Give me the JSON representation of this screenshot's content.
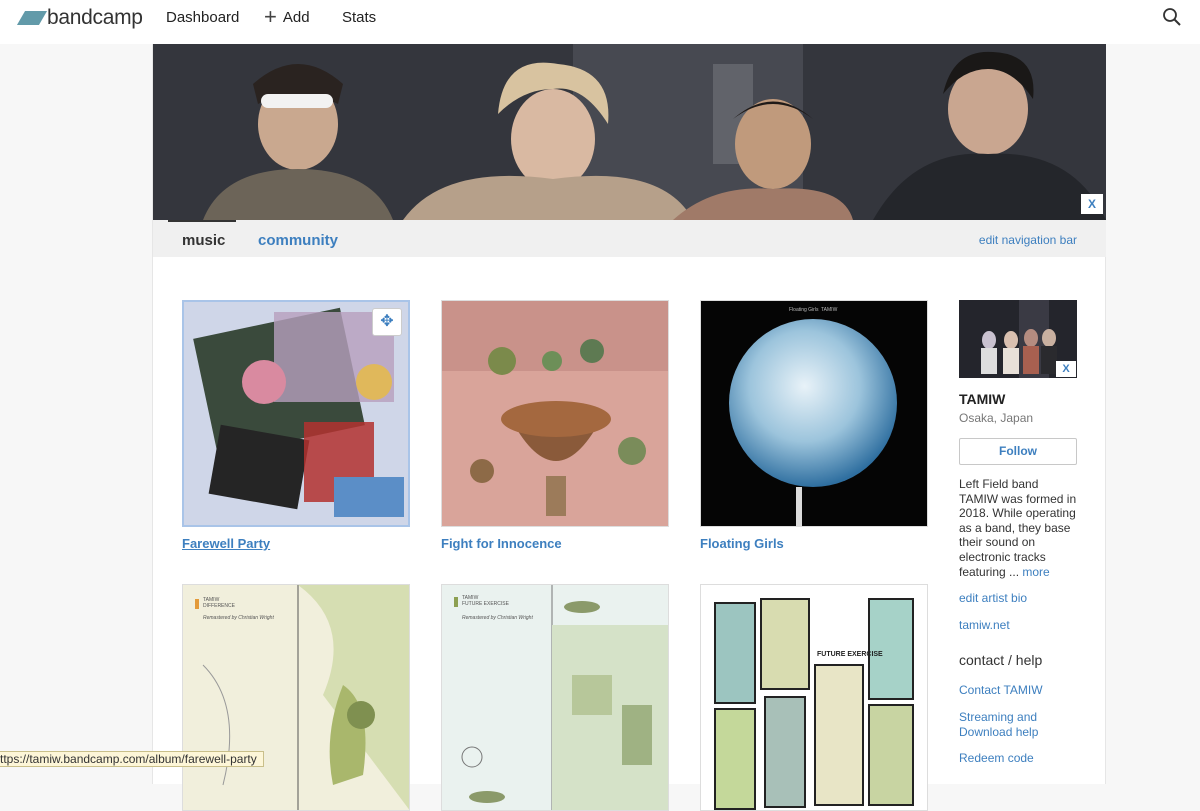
{
  "topbar": {
    "logo_text": "bandcamp",
    "nav": {
      "dashboard": "Dashboard",
      "add": "Add",
      "stats": "Stats"
    }
  },
  "hero": {
    "close_label": "X"
  },
  "tabs": {
    "music": "music",
    "community": "community",
    "edit_nav": "edit navigation bar"
  },
  "albums": [
    {
      "title": "Farewell Party"
    },
    {
      "title": "Fight for Innocence"
    },
    {
      "title": "Floating Girls"
    },
    {
      "label_line1": "TAMIW",
      "label_line2": "DIFFERENCE",
      "credit": "Remastered by Christian Wright"
    },
    {
      "label_line1": "TAMIW",
      "label_line2": "FUTURE EXERCISE",
      "credit": "Remastered by Christian Wright"
    },
    {
      "art_text": "FUTURE EXERCISE"
    }
  ],
  "album_art_text": {
    "floating_girls_header_left": "Floating Girls",
    "floating_girls_header_right": "TAMIW"
  },
  "sidebar": {
    "photo_close_label": "X",
    "artist_name": "TAMIW",
    "location": "Osaka, Japan",
    "follow_label": "Follow",
    "bio": "Left Field band TAMIW was formed in 2018. While operating as a band, they base their sound on electronic tracks featuring ... ",
    "more_label": "more",
    "edit_bio": "edit artist bio",
    "website": "tamiw.net",
    "contact_heading": "contact / help",
    "contact_link": "Contact TAMIW",
    "streaming_help": "Streaming and Download help",
    "redeem": "Redeem code"
  },
  "status_url": "ttps://tamiw.bandcamp.com/album/farewell-party",
  "colors": {
    "link": "#3d7fbf",
    "logo": "#629aa9",
    "status_bg": "#fdf6d8"
  }
}
